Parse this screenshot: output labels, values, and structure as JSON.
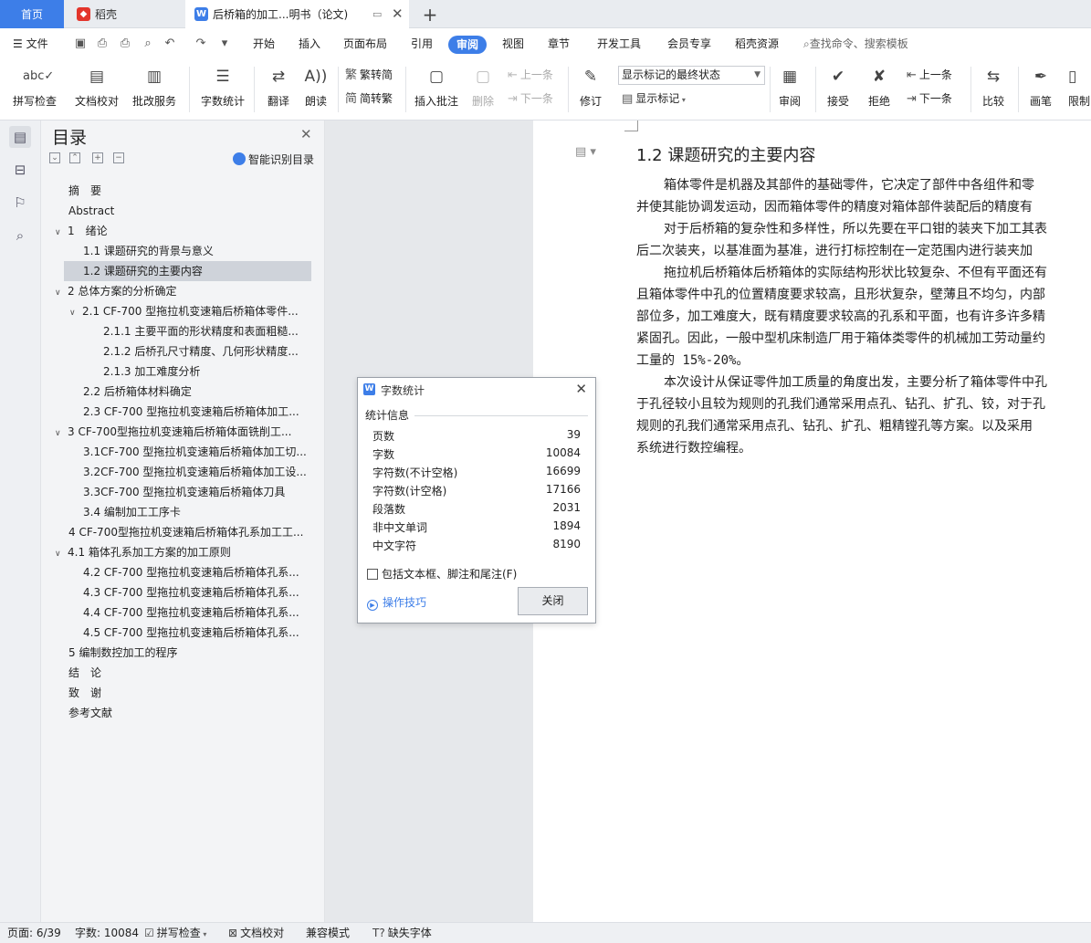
{
  "tabs": {
    "home": "首页",
    "daoke": "稻壳",
    "document": "后桥箱的加工...明书（论文)"
  },
  "menu": {
    "file": "文件",
    "items": [
      "开始",
      "插入",
      "页面布局",
      "引用",
      "审阅",
      "视图",
      "章节",
      "开发工具",
      "会员专享",
      "稻壳资源"
    ],
    "active": "审阅",
    "search_placeholder": "查找命令、搜索模板"
  },
  "ribbon": {
    "spell_check": "拼写检查",
    "doc_proof": "文档校对",
    "review_service": "批改服务",
    "word_count": "字数统计",
    "translate": "翻译",
    "read_aloud": "朗读",
    "trad_to_simp": "繁转简",
    "simp_to_trad": "简转繁",
    "insert_comment": "插入批注",
    "delete": "删除",
    "prev_comment": "上一条",
    "next_comment": "下一条",
    "revise": "修订",
    "markup_mode": "显示标记的最终状态",
    "show_markup": "显示标记",
    "review": "审阅",
    "accept": "接受",
    "reject": "拒绝",
    "prev_change": "上一条",
    "next_change": "下一条",
    "compare": "比较",
    "pen": "画笔",
    "restrict": "限制"
  },
  "icons": {
    "spell_check": "abc-check-icon",
    "doc_proof": "document-proof-icon",
    "review_service": "review-service-icon",
    "word_count": "word-count-icon",
    "translate": "translate-icon",
    "read_aloud": "read-aloud-icon",
    "comment": "comment-icon",
    "revise": "revise-icon",
    "accept": "accept-icon",
    "reject": "reject-icon",
    "compare": "compare-icon",
    "pen": "pen-icon"
  },
  "toc": {
    "title": "目录",
    "smart_button": "智能识别目录",
    "items": [
      {
        "text": "摘　要",
        "level": 0,
        "arrow": ""
      },
      {
        "text": "Abstract",
        "level": 0,
        "arrow": ""
      },
      {
        "text": "1　绪论",
        "level": 0,
        "arrow": "v"
      },
      {
        "text": "1.1 课题研究的背景与意义",
        "level": 1,
        "arrow": ""
      },
      {
        "text": "1.2 课题研究的主要内容",
        "level": 1,
        "arrow": "",
        "selected": true
      },
      {
        "text": "2 总体方案的分析确定",
        "level": 0,
        "arrow": "v"
      },
      {
        "text": "2.1 CF-700 型拖拉机变速箱后桥箱体零件...",
        "level": 1,
        "arrow": "v"
      },
      {
        "text": "2.1.1 主要平面的形状精度和表面粗糙...",
        "level": 2,
        "arrow": ""
      },
      {
        "text": "2.1.2 后桥孔尺寸精度、几何形状精度...",
        "level": 2,
        "arrow": ""
      },
      {
        "text": "2.1.3 加工难度分析",
        "level": 2,
        "arrow": ""
      },
      {
        "text": "2.2 后桥箱体材料确定",
        "level": 1,
        "arrow": ""
      },
      {
        "text": "2.3 CF-700 型拖拉机变速箱后桥箱体加工...",
        "level": 1,
        "arrow": ""
      },
      {
        "text": "3 CF-700型拖拉机变速箱后桥箱体面铣削工...",
        "level": 0,
        "arrow": "v"
      },
      {
        "text": "3.1CF-700 型拖拉机变速箱后桥箱体加工切...",
        "level": 1,
        "arrow": ""
      },
      {
        "text": "3.2CF-700 型拖拉机变速箱后桥箱体加工设...",
        "level": 1,
        "arrow": ""
      },
      {
        "text": "3.3CF-700 型拖拉机变速箱后桥箱体刀具",
        "level": 1,
        "arrow": ""
      },
      {
        "text": "3.4 编制加工工序卡",
        "level": 1,
        "arrow": ""
      },
      {
        "text": "4 CF-700型拖拉机变速箱后桥箱体孔系加工工...",
        "level": 0,
        "arrow": ""
      },
      {
        "text": "4.1 箱体孔系加工方案的加工原则",
        "level": 0,
        "arrow": "v"
      },
      {
        "text": "4.2 CF-700 型拖拉机变速箱后桥箱体孔系...",
        "level": 1,
        "arrow": ""
      },
      {
        "text": "4.3 CF-700 型拖拉机变速箱后桥箱体孔系...",
        "level": 1,
        "arrow": ""
      },
      {
        "text": "4.4 CF-700 型拖拉机变速箱后桥箱体孔系...",
        "level": 1,
        "arrow": ""
      },
      {
        "text": "4.5 CF-700 型拖拉机变速箱后桥箱体孔系...",
        "level": 1,
        "arrow": ""
      },
      {
        "text": "5 编制数控加工的程序",
        "level": 0,
        "arrow": ""
      },
      {
        "text": "结　论",
        "level": 0,
        "arrow": ""
      },
      {
        "text": "致　谢",
        "level": 0,
        "arrow": ""
      },
      {
        "text": "参考文献",
        "level": 0,
        "arrow": ""
      }
    ]
  },
  "document": {
    "heading": "1.2 课题研究的主要内容",
    "lines": [
      {
        "text": "箱体零件是机器及其部件的基础零件，它决定了部件中各组件和零",
        "indent": true
      },
      {
        "text": "并使其能协调发运动，因而箱体零件的精度对箱体部件装配后的精度有",
        "indent": false
      },
      {
        "text": "对于后桥箱的复杂性和多样性，所以先要在平口钳的装夹下加工其表",
        "indent": true
      },
      {
        "text": "后二次装夹，以基准面为基准，进行打标控制在一定范围内进行装夹加",
        "indent": false
      },
      {
        "text": "拖拉机后桥箱体后桥箱体的实际结构形状比较复杂、不但有平面还有",
        "indent": true
      },
      {
        "text": "且箱体零件中孔的位置精度要求较高，且形状复杂，壁薄且不均匀，内部",
        "indent": false
      },
      {
        "text": "部位多，加工难度大，既有精度要求较高的孔系和平面，也有许多许多精",
        "indent": false
      },
      {
        "text": "紧固孔。因此，一般中型机床制造厂用于箱体类零件的机械加工劳动量约",
        "indent": false
      },
      {
        "text": "工量的 15%-20%。",
        "indent": false
      },
      {
        "text": "本次设计从保证零件加工质量的角度出发，主要分析了箱体零件中孔",
        "indent": true
      },
      {
        "text": "于孔径较小且较为规则的孔我们通常采用点孔、钻孔、扩孔、铰，对于孔",
        "indent": false
      },
      {
        "text": "规则的孔我们通常采用点孔、钻孔、扩孔、粗精镗孔等方案。以及采用",
        "indent": false
      },
      {
        "text": "系统进行数控编程。",
        "indent": false
      }
    ]
  },
  "dialog": {
    "title": "字数统计",
    "section": "统计信息",
    "stats": [
      {
        "label": "页数",
        "value": "39"
      },
      {
        "label": "字数",
        "value": "10084"
      },
      {
        "label": "字符数(不计空格)",
        "value": "16699"
      },
      {
        "label": "字符数(计空格)",
        "value": "17166"
      },
      {
        "label": "段落数",
        "value": "2031"
      },
      {
        "label": "非中文单词",
        "value": "1894"
      },
      {
        "label": "中文字符",
        "value": "8190"
      }
    ],
    "include_label": "包括文本框、脚注和尾注(F)",
    "include_checked": false,
    "tips": "操作技巧",
    "close": "关闭"
  },
  "status": {
    "page": "页面: 6/39",
    "words": "字数: 10084",
    "spell": "拼写检查",
    "proof": "文档校对",
    "compat": "兼容模式",
    "missing_font": "缺失字体"
  },
  "colors": {
    "accent": "#3d7ee8",
    "daoke_red": "#e3352b"
  }
}
